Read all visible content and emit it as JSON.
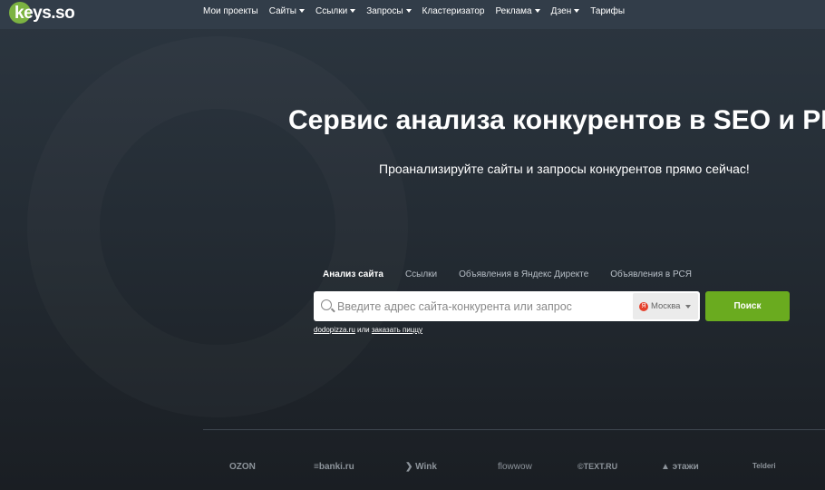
{
  "nav": {
    "logo": "keys.so",
    "items": [
      {
        "label": "Мои проекты",
        "dropdown": false
      },
      {
        "label": "Сайты",
        "dropdown": true
      },
      {
        "label": "Ссылки",
        "dropdown": true
      },
      {
        "label": "Запросы",
        "dropdown": true
      },
      {
        "label": "Кластеризатор",
        "dropdown": false
      },
      {
        "label": "Реклама",
        "dropdown": true
      },
      {
        "label": "Дзен",
        "dropdown": true
      },
      {
        "label": "Тарифы",
        "dropdown": false
      }
    ]
  },
  "hero": {
    "title": "Сервис анализа конкурентов в SEO и PPC",
    "subtitle": "Проанализируйте сайты и запросы конкурентов прямо сейчас!"
  },
  "tabs": [
    "Анализ сайта",
    "Ссылки",
    "Объявления в Яндекс Директе",
    "Объявления в РСЯ"
  ],
  "search": {
    "placeholder": "Введите адрес сайта-конкурента или запрос",
    "value": "",
    "region": "Москва",
    "region_icon": "Я",
    "button": "Поиск"
  },
  "examples": {
    "first": "dodopizza.ru",
    "or": "или",
    "second": "заказать пиццу"
  },
  "brands": [
    "OZON",
    "≡banki.ru",
    "❯ Wink",
    "flowwow",
    "©TEXT.RU",
    "▲ этажи",
    "Telderi"
  ],
  "colors": {
    "accent": "#6aab1f",
    "nav": "#323d49"
  }
}
